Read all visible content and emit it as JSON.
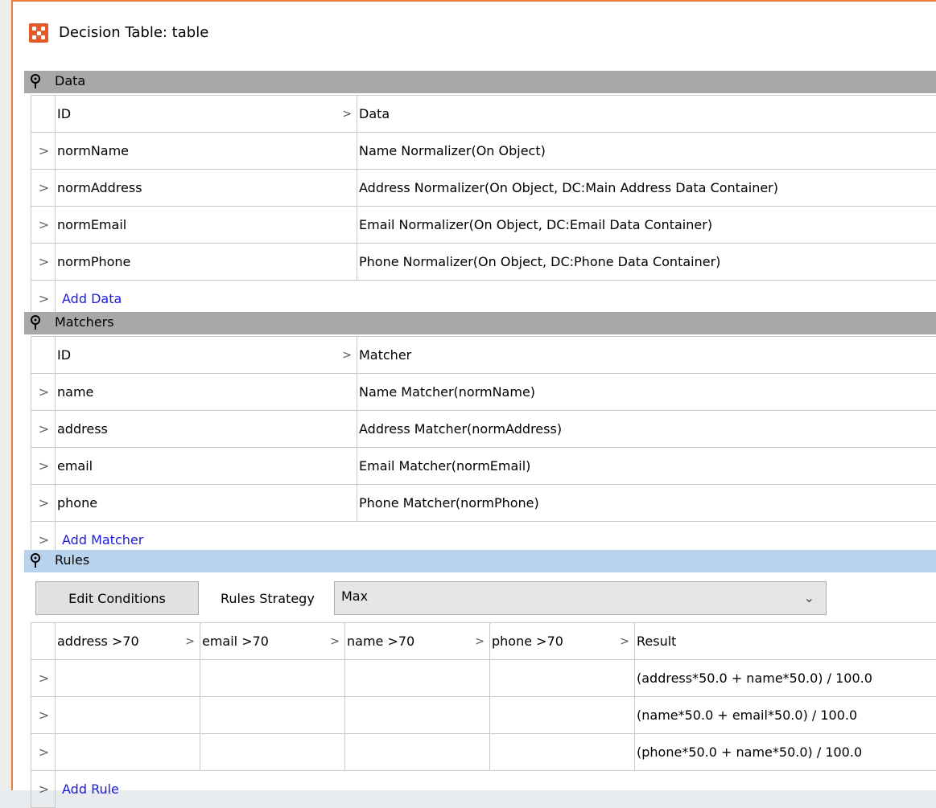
{
  "window": {
    "title": "Decision Table: table"
  },
  "data_section": {
    "title": "Data",
    "columns": [
      "ID",
      "Data"
    ],
    "rows": [
      {
        "id": "normName",
        "value": "Name Normalizer(On Object)"
      },
      {
        "id": "normAddress",
        "value": "Address Normalizer(On Object, DC:Main Address Data Container)"
      },
      {
        "id": "normEmail",
        "value": "Email Normalizer(On Object, DC:Email Data Container)"
      },
      {
        "id": "normPhone",
        "value": "Phone Normalizer(On Object, DC:Phone Data Container)"
      }
    ],
    "add_label": "Add Data"
  },
  "matchers_section": {
    "title": "Matchers",
    "columns": [
      "ID",
      "Matcher"
    ],
    "rows": [
      {
        "id": "name",
        "value": "Name Matcher(normName)"
      },
      {
        "id": "address",
        "value": "Address Matcher(normAddress)"
      },
      {
        "id": "email",
        "value": "Email Matcher(normEmail)"
      },
      {
        "id": "phone",
        "value": "Phone Matcher(normPhone)"
      }
    ],
    "add_label": "Add Matcher"
  },
  "rules_section": {
    "title": "Rules",
    "edit_conditions_label": "Edit Conditions",
    "strategy_label": "Rules Strategy",
    "strategy_value": "Max",
    "columns": [
      "address >70",
      "email >70",
      "name >70",
      "phone >70",
      "Result"
    ],
    "rows": [
      {
        "result": "(address*50.0 + name*50.0) / 100.0"
      },
      {
        "result": "(name*50.0 + email*50.0) / 100.0"
      },
      {
        "result": "(phone*50.0 + name*50.0) / 100.0"
      }
    ],
    "add_label": "Add Rule"
  },
  "colors": {
    "accent": "#e8803a",
    "section_header": "#a8a8a8",
    "rules_header": "#b9d3ee",
    "link": "#1a1ae0"
  }
}
